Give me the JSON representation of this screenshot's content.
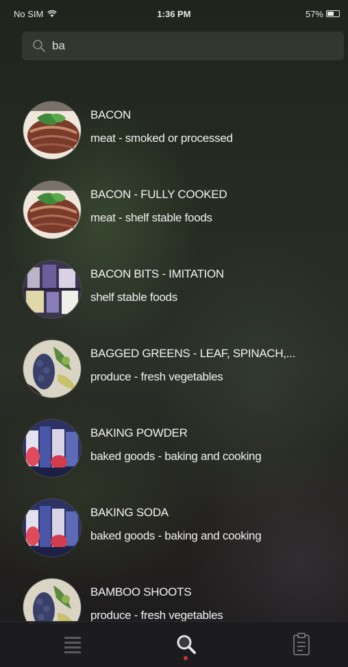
{
  "status_bar": {
    "carrier": "No SIM",
    "time": "1:36 PM",
    "battery_text": "57%",
    "battery_level": 0.57
  },
  "search": {
    "value": "ba",
    "icon": "search-icon"
  },
  "results": [
    {
      "title": "BACON",
      "subtitle": "meat - smoked or processed",
      "thumb": "steak"
    },
    {
      "title": "BACON - FULLY COOKED",
      "subtitle": "meat - shelf stable foods",
      "thumb": "steak"
    },
    {
      "title": "BACON BITS - IMITATION",
      "subtitle": "shelf stable foods",
      "thumb": "pantry"
    },
    {
      "title": "BAGGED GREENS - LEAF, SPINACH,...",
      "subtitle": "produce - fresh vegetables",
      "thumb": "produce"
    },
    {
      "title": "BAKING POWDER",
      "subtitle": "baked goods - baking and cooking",
      "thumb": "baked"
    },
    {
      "title": "BAKING SODA",
      "subtitle": "baked goods - baking and cooking",
      "thumb": "baked"
    },
    {
      "title": "BAMBOO SHOOTS",
      "subtitle": "produce - fresh vegetables",
      "thumb": "produce"
    }
  ],
  "tab_bar": {
    "tabs": [
      {
        "name": "list",
        "icon": "list-icon",
        "active": false
      },
      {
        "name": "search",
        "icon": "search-icon",
        "active": true
      },
      {
        "name": "clipboard",
        "icon": "clipboard-icon",
        "active": false
      }
    ],
    "active_color": "#d0303a"
  }
}
